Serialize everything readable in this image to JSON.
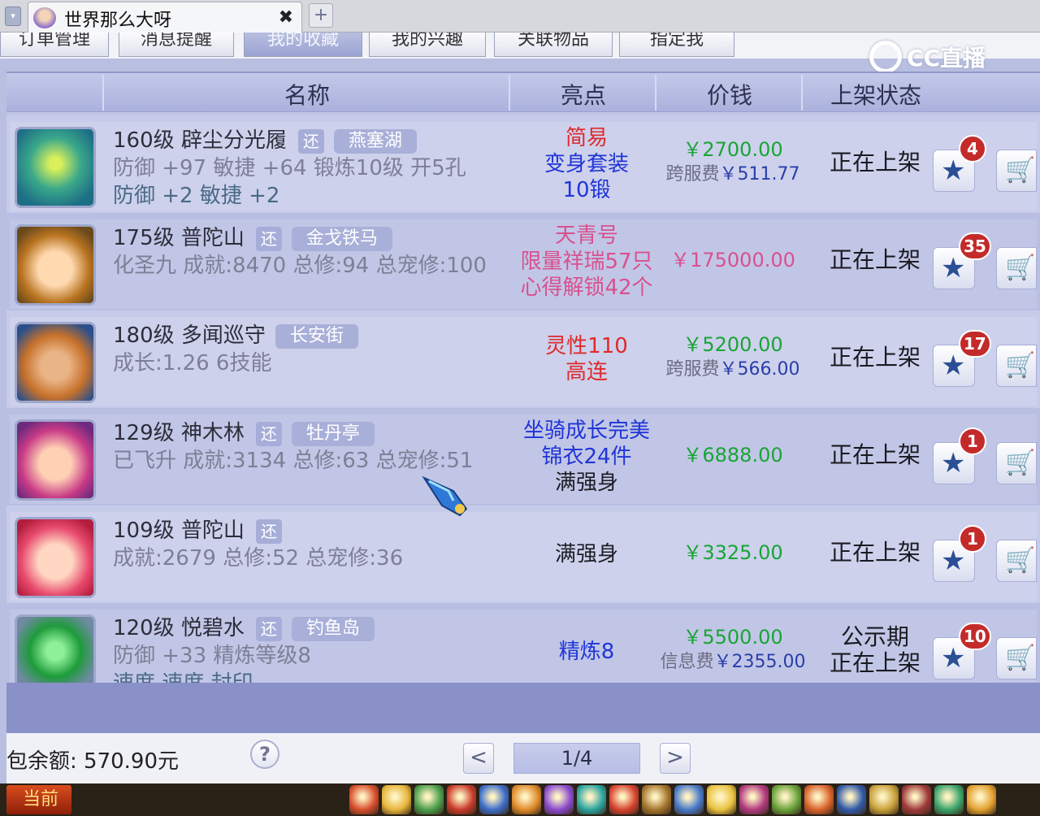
{
  "window": {
    "tab_title": "世界那么大呀",
    "close_glyph": "✖",
    "add_glyph": "+"
  },
  "nav": {
    "tabs": [
      {
        "label": "订单管理"
      },
      {
        "label": "消息提醒"
      },
      {
        "label": "我的收藏"
      },
      {
        "label": "我的兴趣"
      },
      {
        "label": "关联物品"
      },
      {
        "label": "指定我"
      }
    ]
  },
  "logo": {
    "text": "CC直播"
  },
  "table": {
    "headers": [
      "名称",
      "亮点",
      "价钱",
      "上架状态"
    ],
    "rows": [
      {
        "level_name": "160级 辟尘分光履",
        "huan": "还",
        "location": "燕塞湖",
        "line2": "防御 +97 敏捷 +64 锻炼10级 开5孔",
        "line3": "防御 +2 敏捷 +2",
        "highlights": [
          {
            "text": "简易",
            "color": "#e02a2a"
          },
          {
            "text": "变身套装",
            "color": "#2035d8"
          },
          {
            "text": "10锻",
            "color": "#2035d8"
          }
        ],
        "price": "￥2700.00",
        "price_color": "#19a535",
        "fee_label": "跨服费",
        "fee_value": "￥511.77",
        "status_lines": [
          "正在上架"
        ],
        "fav_count": "4"
      },
      {
        "level_name": "175级 普陀山",
        "huan": "还",
        "location": "金戈铁马",
        "line2": "化圣九 成就:8470 总修:94 总宠修:100",
        "line3": "",
        "highlights": [
          {
            "text": "天青号",
            "color": "#d9508e"
          },
          {
            "text": "限量祥瑞57只",
            "color": "#d9508e"
          },
          {
            "text": "心得解锁42个",
            "color": "#d9508e"
          }
        ],
        "price": "￥175000.00",
        "price_color": "#d9508e",
        "fee_label": "",
        "fee_value": "",
        "status_lines": [
          "正在上架"
        ],
        "fav_count": "35"
      },
      {
        "level_name": "180级 多闻巡守",
        "huan": "",
        "location": "长安街",
        "line2": "成长:1.26 6技能",
        "line3": "",
        "highlights": [
          {
            "text": "灵性110",
            "color": "#e02a2a"
          },
          {
            "text": "高连",
            "color": "#e02a2a"
          }
        ],
        "price": "￥5200.00",
        "price_color": "#19a535",
        "fee_label": "跨服费",
        "fee_value": "￥566.00",
        "status_lines": [
          "正在上架"
        ],
        "fav_count": "17"
      },
      {
        "level_name": "129级 神木林",
        "huan": "还",
        "location": "牡丹亭",
        "line2": "已飞升 成就:3134 总修:63 总宠修:51",
        "line3": "",
        "highlights": [
          {
            "text": "坐骑成长完美",
            "color": "#2035d8"
          },
          {
            "text": "锦衣24件",
            "color": "#2035d8"
          },
          {
            "text": "满强身",
            "color": "#1d1d24"
          }
        ],
        "price": "￥6888.00",
        "price_color": "#19a535",
        "fee_label": "",
        "fee_value": "",
        "status_lines": [
          "正在上架"
        ],
        "fav_count": "1"
      },
      {
        "level_name": "109级 普陀山",
        "huan": "还",
        "location": "",
        "line2": "成就:2679 总修:52 总宠修:36",
        "line3": "",
        "highlights": [
          {
            "text": "满强身",
            "color": "#1d1d24"
          }
        ],
        "price": "￥3325.00",
        "price_color": "#19a535",
        "fee_label": "",
        "fee_value": "",
        "status_lines": [
          "正在上架"
        ],
        "fav_count": "1"
      },
      {
        "level_name": "120级 悦碧水",
        "huan": "还",
        "location": "钓鱼岛",
        "line2": "防御 +33 精炼等级8",
        "line3": "速度 速度 封印",
        "highlights": [
          {
            "text": "精炼8",
            "color": "#2035d8"
          }
        ],
        "price": "￥5500.00",
        "price_color": "#19a535",
        "fee_label": "信息费",
        "fee_value": "￥2355.00",
        "status_lines": [
          "公示期",
          "正在上架"
        ],
        "fav_count": "10"
      }
    ]
  },
  "footer": {
    "balance": "包余额: 570.90元",
    "help": "?",
    "prev": "<",
    "page": "1/4",
    "next": ">"
  },
  "taskbar": {
    "current": "当前"
  },
  "colors": {
    "header_bg": "#aab1dc",
    "row_odd": "#c6cbea",
    "row_even": "#b9bfe3",
    "badge_red": "#c42a2a",
    "star_blue": "#2a4f94"
  },
  "icons": {
    "star": "★",
    "cart": "🛒"
  }
}
